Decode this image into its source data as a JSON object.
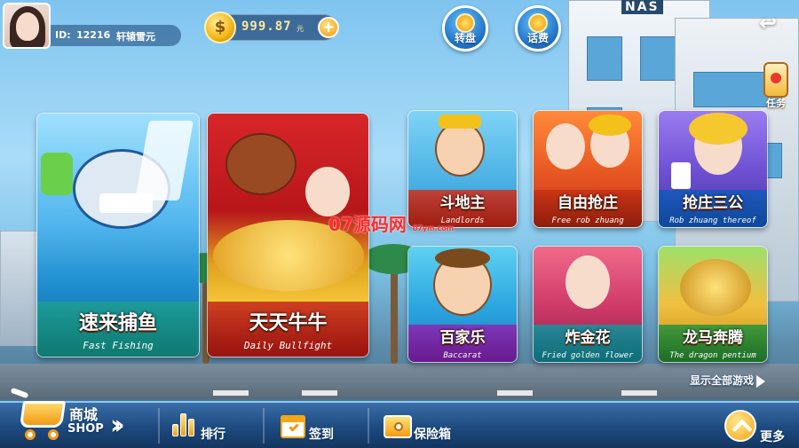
{
  "user": {
    "id_label": "ID:",
    "id_value": "12216",
    "nickname": "轩辕雪元"
  },
  "wallet": {
    "amount": "999.87",
    "unit": "元",
    "coin_symbol": "$"
  },
  "top_buttons": {
    "wheel_label": "转盘",
    "phone_credit_label": "话费",
    "task_label": "任务"
  },
  "scenery": {
    "building_sign": "NAS"
  },
  "games": [
    {
      "title": "速来捕鱼",
      "subtitle": "Fast Fishing"
    },
    {
      "title": "天天牛牛",
      "subtitle": "Daily Bullfight"
    },
    {
      "title": "斗地主",
      "subtitle": "Landlords"
    },
    {
      "title": "自由抢庄",
      "subtitle": "Free rob zhuang"
    },
    {
      "title": "抢庄三公",
      "subtitle": "Rob zhuang thereof"
    },
    {
      "title": "百家乐",
      "subtitle": "Baccarat"
    },
    {
      "title": "炸金花",
      "subtitle": "Fried golden flower"
    },
    {
      "title": "龙马奔腾",
      "subtitle": "The dragon pentium"
    }
  ],
  "watermark": {
    "text": "07源码网",
    "small": "07ym.com"
  },
  "show_all_label": "显示全部游戏",
  "bottom_bar": {
    "shop_zh": "商城",
    "shop_en": "SHOP",
    "rank_label": "排行",
    "signin_label": "签到",
    "safe_label": "保险箱",
    "more_label": "更多"
  },
  "icons": {
    "back": "back-arrow-icon",
    "cart": "shopping-cart-icon",
    "rank": "bar-chart-icon",
    "signin": "calendar-check-icon",
    "safe": "safe-box-icon",
    "more": "chevron-up-icon"
  },
  "colors": {
    "accent_gold": "#f29c10",
    "bar_blue": "#1d4a80",
    "watermark_red": "#ff2a2a"
  }
}
